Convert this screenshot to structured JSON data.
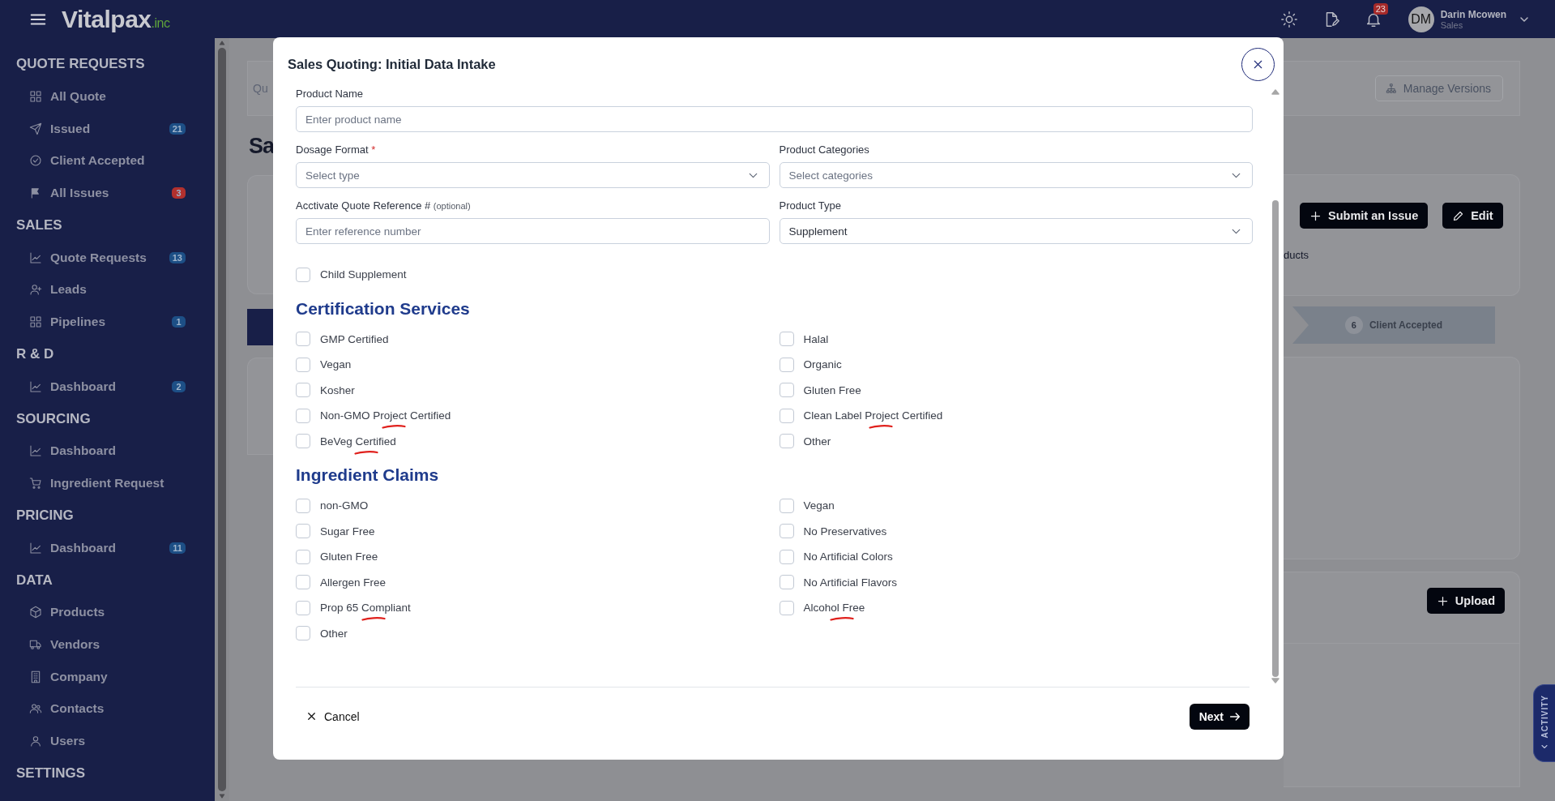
{
  "header": {
    "logo": "Vitalpax",
    "logo_suffix": ".inc",
    "notification_count": "23",
    "user": {
      "initials": "DM",
      "name": "Darin Mcowen",
      "role": "Sales"
    }
  },
  "sidebar": {
    "sections": [
      {
        "title": "QUOTE REQUESTS",
        "items": [
          {
            "label": "All Quote",
            "kind": "grid"
          },
          {
            "label": "Issued",
            "kind": "send",
            "badge": {
              "text": "21",
              "color": "#1d4f86"
            }
          },
          {
            "label": "Client Accepted",
            "kind": "check"
          },
          {
            "label": "All Issues",
            "kind": "flag",
            "badge": {
              "text": "3",
              "color": "#b1302e"
            }
          }
        ]
      },
      {
        "title": "SALES",
        "items": [
          {
            "label": "Quote Requests",
            "kind": "chart",
            "badge": {
              "text": "13",
              "color": "#1d4f86"
            }
          },
          {
            "label": "Leads",
            "kind": "userplus"
          },
          {
            "label": "Pipelines",
            "kind": "grid",
            "badge": {
              "text": "1",
              "color": "#1d4f86"
            }
          }
        ]
      },
      {
        "title": "R & D",
        "items": [
          {
            "label": "Dashboard",
            "kind": "chart",
            "badge": {
              "text": "2",
              "color": "#1d4f86"
            }
          }
        ]
      },
      {
        "title": "SOURCING",
        "items": [
          {
            "label": "Dashboard",
            "kind": "chart"
          },
          {
            "label": "Ingredient Request",
            "kind": "cart"
          }
        ]
      },
      {
        "title": "PRICING",
        "items": [
          {
            "label": "Dashboard",
            "kind": "chart",
            "badge": {
              "text": "11",
              "color": "#1d4f86"
            }
          }
        ]
      },
      {
        "title": "DATA",
        "items": [
          {
            "label": "Products",
            "kind": "box"
          },
          {
            "label": "Vendors",
            "kind": "truck"
          },
          {
            "label": "Company",
            "kind": "building"
          },
          {
            "label": "Contacts",
            "kind": "users"
          },
          {
            "label": "Users",
            "kind": "user"
          }
        ]
      },
      {
        "title": "SETTINGS"
      }
    ]
  },
  "background": {
    "breadcrumb": "Qu",
    "title": "Sa",
    "manage_versions": "Manage Versions",
    "actions": [
      "Submit an Issue",
      "Edit"
    ],
    "fragment": "ducts",
    "step": {
      "number": "6",
      "label": "Client Accepted"
    },
    "upload": "Upload",
    "activity": "ACTIVITY"
  },
  "modal": {
    "title": "Sales Quoting: Initial Data Intake",
    "field_rows": [
      [
        {
          "label": "Product Name",
          "kind": "text",
          "placeholder": "Enter product name"
        }
      ],
      [
        {
          "label": "Dosage Format",
          "required_mark": "*",
          "kind": "select",
          "placeholder": "Select type"
        },
        {
          "label": "Product Categories",
          "kind": "select",
          "placeholder": "Select categories"
        }
      ],
      [
        {
          "label": "Acctivate Quote Reference #",
          "hint": "(optional)",
          "kind": "text",
          "placeholder": "Enter reference number"
        },
        {
          "label": "Product Type",
          "kind": "select",
          "value": "Supplement"
        }
      ]
    ],
    "child_supplement": {
      "label": "Child Supplement",
      "checked": false
    },
    "sections": [
      {
        "title": "Certification Services",
        "options": [
          {
            "label": "GMP Certified",
            "checked": false
          },
          {
            "label": "Halal",
            "checked": false
          },
          {
            "label": "Vegan",
            "checked": false
          },
          {
            "label": "Organic",
            "checked": false
          },
          {
            "label": "Kosher",
            "checked": false
          },
          {
            "label": "Gluten Free",
            "checked": false
          },
          {
            "label": "Non-GMO Project Certified",
            "checked": false,
            "annotated": true
          },
          {
            "label": "Clean Label Project Certified",
            "checked": false,
            "annotated": true
          },
          {
            "label": "BeVeg Certified",
            "checked": false,
            "annotated": true
          },
          {
            "label": "Other",
            "checked": false
          }
        ]
      },
      {
        "title": "Ingredient Claims",
        "options": [
          {
            "label": "non-GMO",
            "checked": false
          },
          {
            "label": "Vegan",
            "checked": false
          },
          {
            "label": "Sugar Free",
            "checked": false
          },
          {
            "label": "No Preservatives",
            "checked": false
          },
          {
            "label": "Gluten Free",
            "checked": false
          },
          {
            "label": "No Artificial Colors",
            "checked": false
          },
          {
            "label": "Allergen Free",
            "checked": false
          },
          {
            "label": "No Artificial Flavors",
            "checked": false
          },
          {
            "label": "Prop 65 Compliant",
            "checked": false,
            "annotated": true
          },
          {
            "label": "Alcohol Free",
            "checked": false,
            "annotated": true
          },
          {
            "label": "Other",
            "checked": false
          }
        ]
      }
    ],
    "footer": {
      "cancel": "Cancel",
      "next": "Next"
    }
  }
}
